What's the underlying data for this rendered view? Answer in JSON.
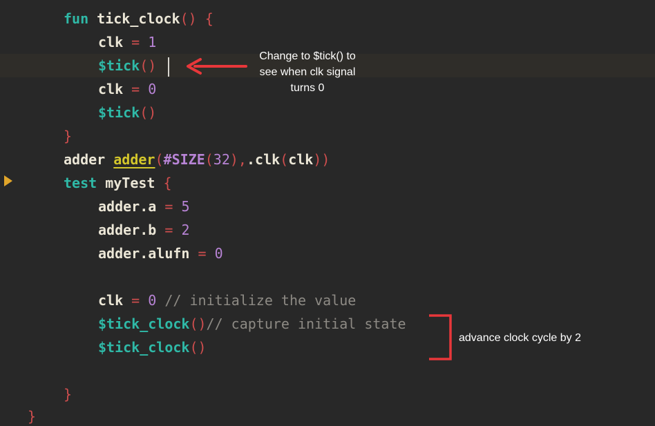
{
  "editor": {
    "lines": [
      {
        "tokens": [
          "fun",
          "tick_clock",
          "()",
          "{"
        ]
      },
      {
        "tokens": [
          "clk",
          "=",
          "1"
        ]
      },
      {
        "tokens": [
          "$tick",
          "()"
        ]
      },
      {
        "tokens": [
          "clk",
          "=",
          "0"
        ]
      },
      {
        "tokens": [
          "$tick",
          "()"
        ]
      },
      {
        "tokens": [
          "}"
        ]
      },
      {
        "tokens": [
          "adder",
          "adder",
          "(",
          "#SIZE",
          "(",
          "32",
          "),",
          ".clk",
          "(",
          "clk",
          "))"
        ]
      },
      {
        "tokens": [
          "test",
          "myTest",
          "{"
        ]
      },
      {
        "tokens": [
          "adder.a",
          "=",
          "5"
        ]
      },
      {
        "tokens": [
          "adder.b",
          "=",
          "2"
        ]
      },
      {
        "tokens": [
          "adder.alufn",
          "=",
          "0"
        ]
      },
      {
        "tokens": []
      },
      {
        "tokens": [
          "clk",
          "=",
          "0",
          "// initialize the value"
        ]
      },
      {
        "tokens": [
          "$tick_clock",
          "()",
          "// capture initial state"
        ]
      },
      {
        "tokens": [
          "$tick_clock",
          "()"
        ]
      },
      {
        "tokens": []
      },
      {
        "tokens": [
          "}"
        ]
      },
      {
        "tokens": [
          "}"
        ]
      }
    ]
  },
  "annotations": {
    "tick_note": "Change to $tick() to see when clk signal turns 0",
    "clock_note": "advance clock cycle by 2"
  },
  "colors": {
    "background": "#282828",
    "keyword": "#2fb9a7",
    "operator": "#d04e4e",
    "number": "#b884d6",
    "comment": "#8d8a84",
    "instance": "#d4c72b",
    "annotation_red": "#e8373a",
    "run_marker": "#e0a52a"
  },
  "icons": {
    "run_marker": "run-test-icon",
    "arrow": "arrow-left-icon",
    "bracket": "bracket-icon"
  }
}
